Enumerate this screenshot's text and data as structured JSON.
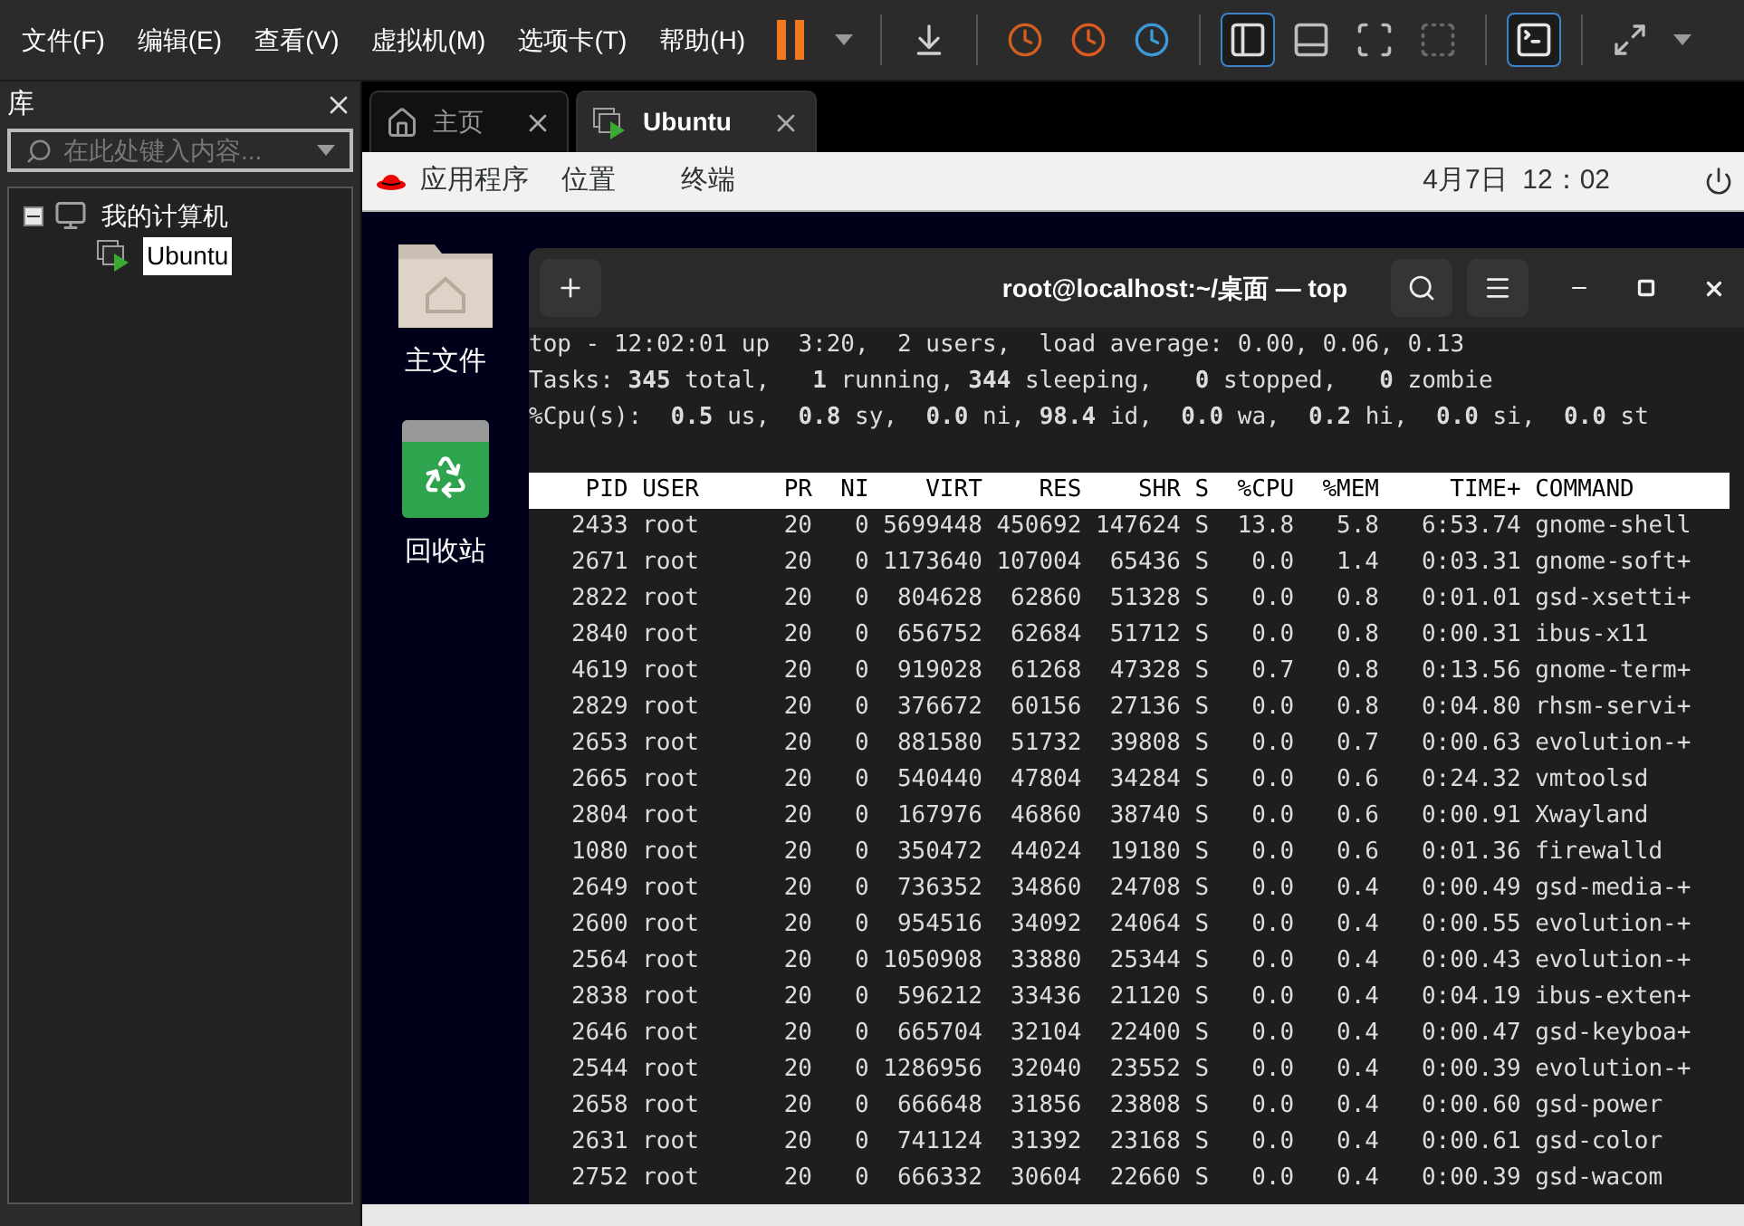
{
  "menu": [
    "文件(F)",
    "编辑(E)",
    "查看(V)",
    "虚拟机(M)",
    "选项卡(T)",
    "帮助(H)"
  ],
  "toolbar": [
    {
      "kind": "pause",
      "selected": false
    },
    {
      "kind": "caret",
      "selected": false
    },
    {
      "kind": "sep",
      "selected": false
    },
    {
      "kind": "send",
      "selected": false
    },
    {
      "kind": "sep",
      "selected": false
    },
    {
      "kind": "snap",
      "selected": false
    },
    {
      "kind": "revert",
      "selected": false
    },
    {
      "kind": "manage",
      "selected": false
    },
    {
      "kind": "sep",
      "selected": false
    },
    {
      "kind": "split",
      "selected": true
    },
    {
      "kind": "bottom",
      "selected": false
    },
    {
      "kind": "full",
      "selected": false
    },
    {
      "kind": "noframe",
      "selected": false
    },
    {
      "kind": "sep",
      "selected": false
    },
    {
      "kind": "console",
      "selected": true
    },
    {
      "kind": "sep",
      "selected": false
    },
    {
      "kind": "stretch",
      "selected": false
    },
    {
      "kind": "caret",
      "selected": false
    }
  ],
  "library": {
    "title": "库",
    "placeholder": "在此处键入内容...",
    "tree": [
      {
        "label": "我的计算机",
        "expanded": true,
        "selected": false,
        "children": [
          {
            "label": "Ubuntu",
            "selected": true
          }
        ]
      }
    ]
  },
  "tabs": [
    {
      "label": "主页",
      "kind": "home",
      "selected": false
    },
    {
      "label": "Ubuntu",
      "kind": "vm",
      "selected": true
    }
  ],
  "guest": {
    "menus": [
      "应用程序",
      "位置",
      "终端"
    ],
    "clock": "4月7日  12：02",
    "desktop_icons": [
      {
        "label": "主文件",
        "kind": "folder"
      },
      {
        "label": "回收站",
        "kind": "trash"
      }
    ],
    "terminal": {
      "title": "root@localhost:~/桌面 — top",
      "summary": [
        "top - 12:02:01 up  3:20,  2 users,  load average: 0.00, 0.06, 0.13",
        "Tasks: **345** total,   **1** running, **344** sleeping,   **0** stopped,   **0** zombie",
        "%Cpu(s):  **0.5** us,  **0.8** sy,  **0.0** ni, **98.4** id,  **0.0** wa,  **0.2** hi,  **0.0** si,  **0.0** st"
      ],
      "columns": [
        "PID",
        "USER",
        "PR",
        "NI",
        "VIRT",
        "RES",
        "SHR",
        "S",
        "%CPU",
        "%MEM",
        "TIME+",
        "COMMAND"
      ],
      "rows": [
        [
          "2433",
          "root",
          "20",
          "0",
          "5699448",
          "450692",
          "147624",
          "S",
          "13.8",
          "5.8",
          "6:53.74",
          "gnome-shell"
        ],
        [
          "2671",
          "root",
          "20",
          "0",
          "1173640",
          "107004",
          "65436",
          "S",
          "0.0",
          "1.4",
          "0:03.31",
          "gnome-soft+"
        ],
        [
          "2822",
          "root",
          "20",
          "0",
          "804628",
          "62860",
          "51328",
          "S",
          "0.0",
          "0.8",
          "0:01.01",
          "gsd-xsetti+"
        ],
        [
          "2840",
          "root",
          "20",
          "0",
          "656752",
          "62684",
          "51712",
          "S",
          "0.0",
          "0.8",
          "0:00.31",
          "ibus-x11"
        ],
        [
          "4619",
          "root",
          "20",
          "0",
          "919028",
          "61268",
          "47328",
          "S",
          "0.7",
          "0.8",
          "0:13.56",
          "gnome-term+"
        ],
        [
          "2829",
          "root",
          "20",
          "0",
          "376672",
          "60156",
          "27136",
          "S",
          "0.0",
          "0.8",
          "0:04.80",
          "rhsm-servi+"
        ],
        [
          "2653",
          "root",
          "20",
          "0",
          "881580",
          "51732",
          "39808",
          "S",
          "0.0",
          "0.7",
          "0:00.63",
          "evolution-+"
        ],
        [
          "2665",
          "root",
          "20",
          "0",
          "540440",
          "47804",
          "34284",
          "S",
          "0.0",
          "0.6",
          "0:24.32",
          "vmtoolsd"
        ],
        [
          "2804",
          "root",
          "20",
          "0",
          "167976",
          "46860",
          "38740",
          "S",
          "0.0",
          "0.6",
          "0:00.91",
          "Xwayland"
        ],
        [
          "1080",
          "root",
          "20",
          "0",
          "350472",
          "44024",
          "19180",
          "S",
          "0.0",
          "0.6",
          "0:01.36",
          "firewalld"
        ],
        [
          "2649",
          "root",
          "20",
          "0",
          "736352",
          "34860",
          "24708",
          "S",
          "0.0",
          "0.4",
          "0:00.49",
          "gsd-media-+"
        ],
        [
          "2600",
          "root",
          "20",
          "0",
          "954516",
          "34092",
          "24064",
          "S",
          "0.0",
          "0.4",
          "0:00.55",
          "evolution-+"
        ],
        [
          "2564",
          "root",
          "20",
          "0",
          "1050908",
          "33880",
          "25344",
          "S",
          "0.0",
          "0.4",
          "0:00.43",
          "evolution-+"
        ],
        [
          "2838",
          "root",
          "20",
          "0",
          "596212",
          "33436",
          "21120",
          "S",
          "0.0",
          "0.4",
          "0:04.19",
          "ibus-exten+"
        ],
        [
          "2646",
          "root",
          "20",
          "0",
          "665704",
          "32104",
          "22400",
          "S",
          "0.0",
          "0.4",
          "0:00.47",
          "gsd-keyboa+"
        ],
        [
          "2544",
          "root",
          "20",
          "0",
          "1286956",
          "32040",
          "23552",
          "S",
          "0.0",
          "0.4",
          "0:00.39",
          "evolution-+"
        ],
        [
          "2658",
          "root",
          "20",
          "0",
          "666648",
          "31856",
          "23808",
          "S",
          "0.0",
          "0.4",
          "0:00.60",
          "gsd-power"
        ],
        [
          "2631",
          "root",
          "20",
          "0",
          "741124",
          "31392",
          "23168",
          "S",
          "0.0",
          "0.4",
          "0:00.61",
          "gsd-color"
        ],
        [
          "2752",
          "root",
          "20",
          "0",
          "666332",
          "30604",
          "22660",
          "S",
          "0.0",
          "0.4",
          "0:00.39",
          "gsd-wacom"
        ]
      ]
    }
  }
}
